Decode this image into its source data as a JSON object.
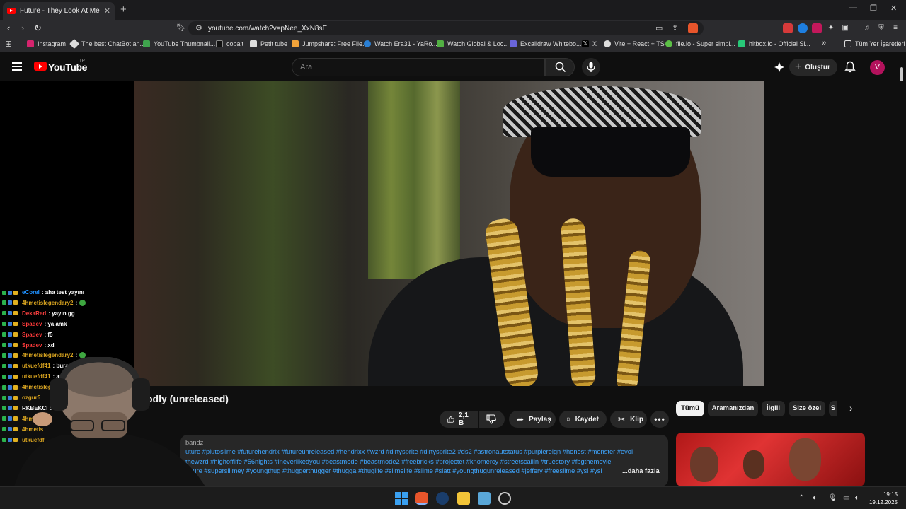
{
  "browser": {
    "tab_title": "Future - They Look At Me Go",
    "url": "youtube.com/watch?v=pNee_XxN8sE",
    "bookmarks": [
      "Instagram",
      "The best ChatBot an...",
      "YouTube Thumbnail...",
      "cobalt",
      "Petit tube",
      "Jumpshare: Free File...",
      "Watch Era31 - YaRo...",
      "Watch Global & Loc...",
      "Excalidraw Whitebo...",
      "X",
      "Vite + React + TS",
      "file.io - Super simpl...",
      "hitbox.io - Official Si..."
    ],
    "all_bookmarks": "Tüm Yer İşaretleri",
    "colors": {
      "tab_bar": "#1b1b1d",
      "toolbar": "#2b2b2e"
    }
  },
  "youtube": {
    "logo_text": "YouTube",
    "logo_superscript": "TR",
    "search_placeholder": "Ara",
    "create_label": "Oluştur",
    "avatar_letter": "V",
    "colors": {
      "brand": "#ff0000",
      "link": "#3ea6ff",
      "avatar": "#b3125c"
    }
  },
  "video": {
    "title_visible": "odly (unreleased)",
    "likes": "2,1 B",
    "share": "Paylaş",
    "save": "Kaydet",
    "clip": "Klip",
    "channel_fragment": "bandz",
    "description_lines": [
      "uture #plutoslime #futurehendrix #futureunreleased #hendrixx #wzrd #dirtysprite #dirtysprite2 #ds2 #astronautstatus #purplereign #honest #monster #evol",
      "thewzrd #highofflife #56nights #ineverlikedyou #beastmode #beastmode2 #freebricks #projectet #knomercy #streetscallin #truestory #fbgthemovie",
      "future #supersliimey #youngthug #thuggerthugger #thugga #thuglife #slimelife #slime #slatt #youngthugunreleased #jeffery #freeslime #ysl #ysl"
    ],
    "more": "...daha fazla"
  },
  "chips": [
    {
      "label": "Tümü",
      "active": true
    },
    {
      "label": "Aramanızdan",
      "active": false
    },
    {
      "label": "İlgili",
      "active": false
    },
    {
      "label": "Size özel",
      "active": false
    },
    {
      "label": "S",
      "active": false
    }
  ],
  "chat": [
    {
      "user": "eCorel",
      "msg": ": aha test yayını",
      "color": "#1e90ff"
    },
    {
      "user": "4hmetislegendary2",
      "msg": ":",
      "color": "#daa520",
      "emote": true
    },
    {
      "user": "DekaRed",
      "msg": ": yayın gg",
      "color": "#ff4040"
    },
    {
      "user": "Spadev",
      "msg": ": ya amk",
      "color": "#ff3b3b"
    },
    {
      "user": "Spadev",
      "msg": ": f5",
      "color": "#ff3b3b"
    },
    {
      "user": "Spadev",
      "msg": ": xd",
      "color": "#ff3b3b"
    },
    {
      "user": "4hmetislegendary2",
      "msg": ":",
      "color": "#daa520",
      "emote": true
    },
    {
      "user": "utkuefdf41",
      "msg": ": burayı k",
      "color": "#daa520"
    },
    {
      "user": "utkuefdf41",
      "msg": ": acil",
      "color": "#daa520"
    },
    {
      "user": "4hmetislege",
      "msg": "",
      "color": "#daa520"
    },
    {
      "user": "ozgur5",
      "msg": "",
      "color": "#daa520"
    },
    {
      "user": "RKBEKCI",
      "msg": ": ne",
      "color": "#ffffff"
    },
    {
      "user": "4hmetis",
      "msg": "",
      "color": "#daa520"
    },
    {
      "user": "4hmetis",
      "msg": "",
      "color": "#daa520"
    },
    {
      "user": "utkuefdf",
      "msg": "",
      "color": "#daa520"
    }
  ],
  "taskbar": {
    "time": "19:15",
    "date": "19.12.2025"
  }
}
